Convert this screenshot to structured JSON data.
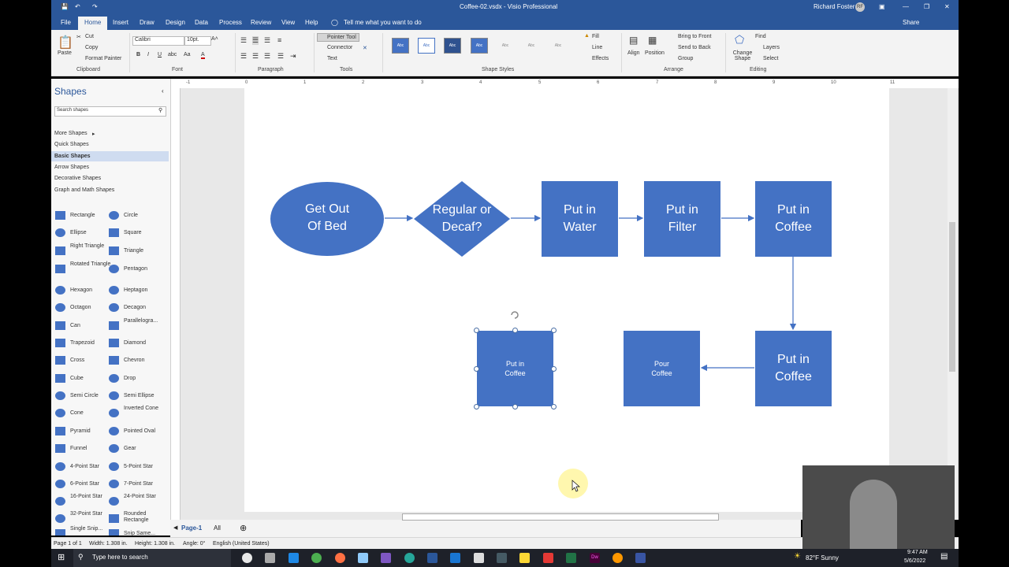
{
  "window": {
    "doc_title": "Coffee-02.vsdx  -  Visio Professional",
    "user": "Richard Foster",
    "user_initials": "RF"
  },
  "tabs": [
    "File",
    "Home",
    "Insert",
    "Draw",
    "Design",
    "Data",
    "Process",
    "Review",
    "View",
    "Help"
  ],
  "tell_me": "Tell me what you want to do",
  "share": "Share",
  "ribbon": {
    "clipboard": {
      "paste": "Paste",
      "cut": "Cut",
      "copy": "Copy",
      "format_painter": "Format Painter",
      "label": "Clipboard"
    },
    "font": {
      "name": "Calibri",
      "size": "10pt.",
      "label": "Font"
    },
    "paragraph": {
      "label": "Paragraph"
    },
    "tools": {
      "pointer": "Pointer Tool",
      "connector": "Connector",
      "text": "Text",
      "label": "Tools"
    },
    "styles": {
      "swatch": "Abc",
      "label": "Shape Styles",
      "fill": "Fill",
      "line": "Line",
      "effects": "Effects"
    },
    "arrange": {
      "align": "Align",
      "position": "Position",
      "bring_front": "Bring to Front",
      "send_back": "Send to Back",
      "group": "Group",
      "label": "Arrange"
    },
    "editing": {
      "change_shape": "Change Shape",
      "find": "Find",
      "layers": "Layers",
      "select": "Select",
      "label": "Editing"
    }
  },
  "ruler": [
    "-1",
    "0",
    "1",
    "2",
    "3",
    "4",
    "5",
    "6",
    "7",
    "8",
    "9",
    "10",
    "11"
  ],
  "shapes_panel": {
    "title": "Shapes",
    "search_placeholder": "Search shapes",
    "categories": [
      "More Shapes",
      "Quick Shapes",
      "Basic Shapes",
      "Arrow Shapes",
      "Decorative Shapes",
      "Graph and Math Shapes"
    ],
    "items": [
      [
        "Rectangle",
        "Circle"
      ],
      [
        "Ellipse",
        "Square"
      ],
      [
        "Right Triangle",
        "Triangle"
      ],
      [
        "Rotated Triangle",
        "Pentagon"
      ],
      [
        "Hexagon",
        "Heptagon"
      ],
      [
        "Octagon",
        "Decagon"
      ],
      [
        "Can",
        "Parallelogra..."
      ],
      [
        "Trapezoid",
        "Diamond"
      ],
      [
        "Cross",
        "Chevron"
      ],
      [
        "Cube",
        "Drop"
      ],
      [
        "Semi Circle",
        "Semi Ellipse"
      ],
      [
        "Cone",
        "Inverted Cone"
      ],
      [
        "Pyramid",
        "Pointed Oval"
      ],
      [
        "Funnel",
        "Gear"
      ],
      [
        "4-Point Star",
        "5-Point Star"
      ],
      [
        "6-Point Star",
        "7-Point Star"
      ],
      [
        "16-Point Star",
        "24-Point Star"
      ],
      [
        "32-Point Star",
        "Rounded Rectangle"
      ],
      [
        "Single Snip...",
        "Snip Same..."
      ]
    ]
  },
  "diagram": {
    "get_out_of_bed": "Get Out Of Bed",
    "regular_or_decaf": "Regular or Decaf?",
    "put_in_water": "Put in Water",
    "put_in_filter": "Put in Filter",
    "put_in_coffee_1": "Put in Coffee",
    "put_in_coffee_2": "Put in Coffee",
    "pour_coffee": "Pour Coffee",
    "put_in_coffee_small": "Put in Coffee"
  },
  "page_tabs": {
    "page": "Page-1",
    "all": "All"
  },
  "status": {
    "page": "Page 1 of 1",
    "width": "Width: 1.308 in.",
    "height": "Height: 1.308 in.",
    "angle": "Angle: 0°",
    "lang": "English (United States)"
  },
  "taskbar": {
    "search": "Type here to search",
    "weather": "82°F  Sunny",
    "time": "9:47 AM",
    "date": "5/6/2022"
  },
  "colors": {
    "shape_fill": "#4472c4",
    "title_bar": "#2b579a"
  }
}
